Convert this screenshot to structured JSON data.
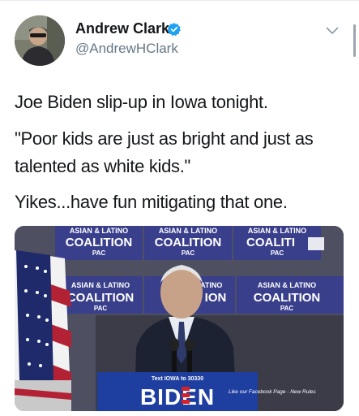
{
  "tweet": {
    "author_name": "Andrew Clark",
    "author_handle": "@AndrewHClark",
    "text_lines": [
      "Joe Biden slip-up in Iowa tonight.",
      "\"Poor kids are just as bright and just as",
      "talented as white kids.\"",
      "Yikes...have fun mitigating that one."
    ]
  },
  "media": {
    "banner_top": [
      "ASIAN & LATINO",
      "ASIAN & LATINO",
      "ASIAN & LATINO"
    ],
    "banner_coalition": [
      "COALITION",
      "COALITION",
      "COALITI"
    ],
    "banner_pac": [
      "PAC",
      "PAC",
      "PAC"
    ],
    "banner2_top": [
      "ASIAN & LATINO",
      "LATINO",
      "ASIAN & LATINO"
    ],
    "banner2_coalition": [
      "COALITION",
      "ION",
      "COALITION"
    ],
    "banner2_pac": [
      "PAC",
      "PAC"
    ],
    "podium_text": "Text IOWA to 30330",
    "podium_logo": "BIDEN",
    "caption": "Like our Facebook Page - New Rules",
    "colors": {
      "banner": "#3a3f8c",
      "podium": "#1f3fa0",
      "flag_red": "#b22234"
    }
  },
  "icons": {
    "verified": "verified-badge-icon",
    "chevron": "chevron-down-icon"
  }
}
